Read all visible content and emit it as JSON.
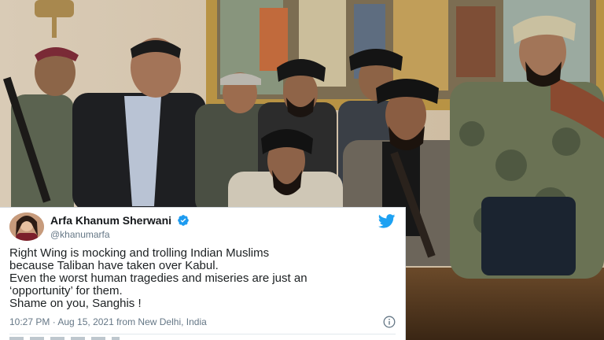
{
  "tweet": {
    "author_name": "Arfa Khanum Sherwani",
    "author_handle": "@khanumarfa",
    "text_lines": [
      "Right Wing is mocking and trolling Indian Muslims",
      "because Taliban have taken over Kabul.",
      "Even the worst human tragedies and miseries are just an",
      "‘opportunity’ for them.",
      "Shame on you, Sanghis !"
    ],
    "meta": "10:27 PM · Aug 15, 2021 from New Delhi, India",
    "verified_icon": "verified-badge-icon",
    "brand_icon": "twitter-bird-icon",
    "info_icon": "info-icon"
  },
  "colors": {
    "twitter_blue": "#1da1f2",
    "verified_blue": "#1d9bf0",
    "name_text": "#14171a",
    "secondary_text": "#657786"
  }
}
